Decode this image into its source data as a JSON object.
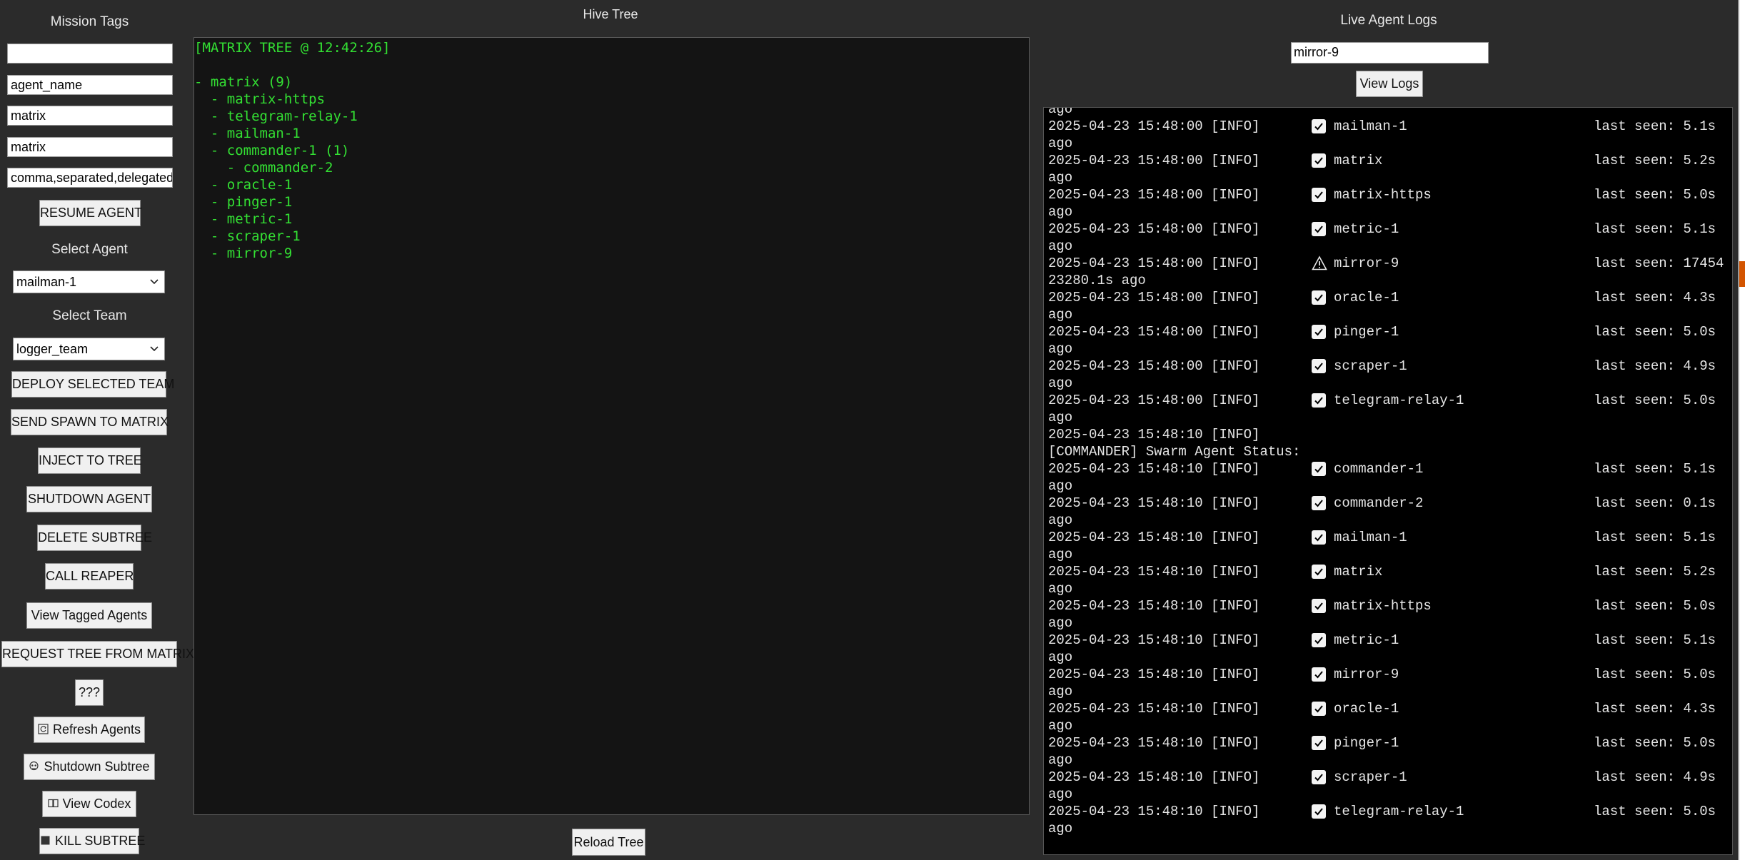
{
  "left": {
    "title": "Mission Tags",
    "inputs": [
      "",
      "agent_name",
      "matrix",
      "matrix",
      "comma,separated,delegated"
    ],
    "resume_label": "RESUME AGENT",
    "select_agent_label": "Select Agent",
    "select_agent_value": "mailman-1",
    "select_team_label": "Select Team",
    "select_team_value": "logger_team",
    "buttons": {
      "deploy": "DEPLOY SELECTED TEAM",
      "spawn": "SEND SPAWN TO MATRIX",
      "inject": "INJECT TO TREE",
      "shutdown_agent": "SHUTDOWN AGENT",
      "delete_subtree": "DELETE SUBTREE",
      "reaper": "CALL REAPER",
      "tagged": "View Tagged Agents",
      "request_tree": "REQUEST TREE FROM MATRIX",
      "mystery": "???",
      "refresh": "Refresh Agents",
      "shutdown_subtree": "Shutdown Subtree",
      "codex": "View Codex",
      "kill": "KILL SUBTREE"
    }
  },
  "tree": {
    "title": "Hive Tree",
    "lines": [
      "[MATRIX TREE @ 12:42:26]",
      "",
      "- matrix (9)",
      "  - matrix-https",
      "  - telegram-relay-1",
      "  - mailman-1",
      "  - commander-1 (1)",
      "    - commander-2",
      "  - oracle-1",
      "  - pinger-1",
      "  - metric-1",
      "  - scraper-1",
      "  - mirror-9"
    ],
    "reload_label": "Reload Tree"
  },
  "logs": {
    "title": "Live Agent Logs",
    "filter_value": "mirror-9",
    "view_label": "View Logs",
    "lines": [
      {
        "kind": "text",
        "text": "ago"
      },
      {
        "kind": "entry",
        "stamp": "2025-04-23 15:48:00 [INFO]",
        "icon": "check",
        "agent": "mailman-1",
        "seen": "last seen: 5.1s"
      },
      {
        "kind": "text",
        "text": "ago"
      },
      {
        "kind": "entry",
        "stamp": "2025-04-23 15:48:00 [INFO]",
        "icon": "check",
        "agent": "matrix",
        "seen": "last seen: 5.2s"
      },
      {
        "kind": "text",
        "text": "ago"
      },
      {
        "kind": "entry",
        "stamp": "2025-04-23 15:48:00 [INFO]",
        "icon": "check",
        "agent": "matrix-https",
        "seen": "last seen: 5.0s"
      },
      {
        "kind": "text",
        "text": "ago"
      },
      {
        "kind": "entry",
        "stamp": "2025-04-23 15:48:00 [INFO]",
        "icon": "check",
        "agent": "metric-1",
        "seen": "last seen: 5.1s"
      },
      {
        "kind": "text",
        "text": "ago"
      },
      {
        "kind": "entry",
        "stamp": "2025-04-23 15:48:00 [INFO]",
        "icon": "warn",
        "agent": "mirror-9",
        "seen": "last seen: 17454"
      },
      {
        "kind": "text",
        "text": "23280.1s ago"
      },
      {
        "kind": "entry",
        "stamp": "2025-04-23 15:48:00 [INFO]",
        "icon": "check",
        "agent": "oracle-1",
        "seen": "last seen: 4.3s"
      },
      {
        "kind": "text",
        "text": "ago"
      },
      {
        "kind": "entry",
        "stamp": "2025-04-23 15:48:00 [INFO]",
        "icon": "check",
        "agent": "pinger-1",
        "seen": "last seen: 5.0s"
      },
      {
        "kind": "text",
        "text": "ago"
      },
      {
        "kind": "entry",
        "stamp": "2025-04-23 15:48:00 [INFO]",
        "icon": "check",
        "agent": "scraper-1",
        "seen": "last seen: 4.9s"
      },
      {
        "kind": "text",
        "text": "ago"
      },
      {
        "kind": "entry",
        "stamp": "2025-04-23 15:48:00 [INFO]",
        "icon": "check",
        "agent": "telegram-relay-1",
        "seen": "last seen: 5.0s"
      },
      {
        "kind": "text",
        "text": "ago"
      },
      {
        "kind": "entry",
        "stamp": "2025-04-23 15:48:10 [INFO]",
        "icon": "none",
        "agent": "",
        "seen": ""
      },
      {
        "kind": "text",
        "text": "[COMMANDER] Swarm Agent Status:"
      },
      {
        "kind": "entry",
        "stamp": "2025-04-23 15:48:10 [INFO]",
        "icon": "check",
        "agent": "commander-1",
        "seen": "last seen: 5.1s"
      },
      {
        "kind": "text",
        "text": "ago"
      },
      {
        "kind": "entry",
        "stamp": "2025-04-23 15:48:10 [INFO]",
        "icon": "check",
        "agent": "commander-2",
        "seen": "last seen: 0.1s"
      },
      {
        "kind": "text",
        "text": "ago"
      },
      {
        "kind": "entry",
        "stamp": "2025-04-23 15:48:10 [INFO]",
        "icon": "check",
        "agent": "mailman-1",
        "seen": "last seen: 5.1s"
      },
      {
        "kind": "text",
        "text": "ago"
      },
      {
        "kind": "entry",
        "stamp": "2025-04-23 15:48:10 [INFO]",
        "icon": "check",
        "agent": "matrix",
        "seen": "last seen: 5.2s"
      },
      {
        "kind": "text",
        "text": "ago"
      },
      {
        "kind": "entry",
        "stamp": "2025-04-23 15:48:10 [INFO]",
        "icon": "check",
        "agent": "matrix-https",
        "seen": "last seen: 5.0s"
      },
      {
        "kind": "text",
        "text": "ago"
      },
      {
        "kind": "entry",
        "stamp": "2025-04-23 15:48:10 [INFO]",
        "icon": "check",
        "agent": "metric-1",
        "seen": "last seen: 5.1s"
      },
      {
        "kind": "text",
        "text": "ago"
      },
      {
        "kind": "entry",
        "stamp": "2025-04-23 15:48:10 [INFO]",
        "icon": "check",
        "agent": "mirror-9",
        "seen": "last seen: 5.0s"
      },
      {
        "kind": "text",
        "text": "ago"
      },
      {
        "kind": "entry",
        "stamp": "2025-04-23 15:48:10 [INFO]",
        "icon": "check",
        "agent": "oracle-1",
        "seen": "last seen: 4.3s"
      },
      {
        "kind": "text",
        "text": "ago"
      },
      {
        "kind": "entry",
        "stamp": "2025-04-23 15:48:10 [INFO]",
        "icon": "check",
        "agent": "pinger-1",
        "seen": "last seen: 5.0s"
      },
      {
        "kind": "text",
        "text": "ago"
      },
      {
        "kind": "entry",
        "stamp": "2025-04-23 15:48:10 [INFO]",
        "icon": "check",
        "agent": "scraper-1",
        "seen": "last seen: 4.9s"
      },
      {
        "kind": "text",
        "text": "ago"
      },
      {
        "kind": "entry",
        "stamp": "2025-04-23 15:48:10 [INFO]",
        "icon": "check",
        "agent": "telegram-relay-1",
        "seen": "last seen: 5.0s"
      },
      {
        "kind": "text",
        "text": "ago"
      }
    ]
  },
  "colors": {
    "background": "#2b2b2b",
    "tree_text": "#33e033",
    "tree_bg": "#141414",
    "log_bg": "#000000",
    "log_text": "#e6e6e6"
  }
}
